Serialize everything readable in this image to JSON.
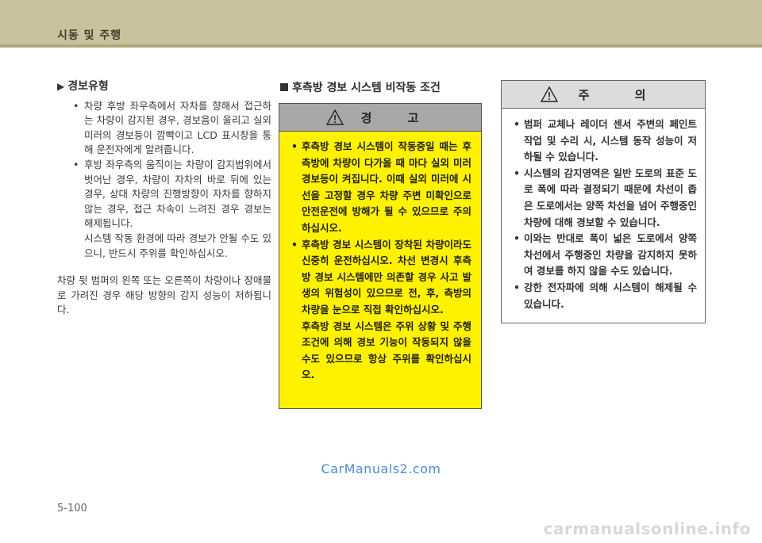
{
  "header": {
    "title": "시동 및 주행"
  },
  "left": {
    "subsection_title": "경보유형",
    "bullets": [
      {
        "lines": [
          "차량 후방 좌우측에서 자차를 향해서 접근하는 차량이 감지된 경우, 경보음이 울리고 실외 미러의 경보등이 깜빡이고 LCD 표시창을 통해 운전자에게 알려줍니다."
        ]
      },
      {
        "lines": [
          "후방 좌우측의 움직이는 차량이 감지범위에서 벗어난 경우, 차량이 자차의 바로 뒤에 있는 경우, 상대 차량의 진행방향이 자차를 향하지 않는 경우, 접근 차속이 느려진 경우 경보는 해제됩니다."
        ],
        "continuation": "시스템 작동 환경에 따라 경보가 안될 수도 있으니, 반드시 주위를 확인하십시오."
      }
    ],
    "paragraph": "차량 뒷 범퍼의 왼쪽 또는 오른쪽이 차량이나 장애물로 가려진 경우 해당 방향의 감지 성능이 저하됩니다."
  },
  "middle": {
    "section_title": "후측방 경보 시스템 비작동 조건",
    "warning": {
      "label": "경 고",
      "bullets": [
        {
          "text": "후측방 경보 시스템이 작동중일 때는 후측방에 차량이 다가올 때 마다 실외 미러 경보등이 켜집니다. 이때 실외 미러에 시선을 고정할 경우 차량 주변 미확인으로 안전운전에 방해가 될 수 있으므로 주의하십시오."
        },
        {
          "text": "후측방 경보 시스템이 장착된 차량이라도 신중히 운전하십시오. 차선 변경시 후측방 경보 시스템에만 의존할 경우 사고 발생의 위험성이 있으므로 전, 후, 측방의 차량을 눈으로 직접 확인하십시오.",
          "continuation": "후측방 경보 시스템은 주위 상황 및 주행 조건에 의해 경보 기능이 작동되지 않을 수도 있으므로 항상 주위를 확인하십시오."
        }
      ]
    }
  },
  "right": {
    "caution": {
      "label": "주 의",
      "bullets": [
        "범퍼 교체나 레이더 센서 주변의 페인트 작업 및 수리 시, 시스템 동작 성능이 저하될 수 있습니다.",
        "시스템의 감지영역은 일반 도로의 표준 도로 폭에 따라 결정되기 때문에 차선이 좁은 도로에서는 양쪽 차선을 넘어 주행중인 차량에 대해 경보할 수 있습니다.",
        "이와는 반대로 폭이 넓은 도로에서 양쪽 차선에서 주행중인 차량을 감지하지 못하여 경보를 하지 않을 수도 있습니다.",
        "강한 전자파에 의해 시스템이 해제될 수 있습니다."
      ]
    }
  },
  "watermark": "CarManuals2.com",
  "page_number": "5-100",
  "footer_mark": "carmanualsonline.info",
  "colors": {
    "header": "#c9c29c",
    "warning_bg": "#fff200",
    "caution_head": "#dcdcdc"
  }
}
